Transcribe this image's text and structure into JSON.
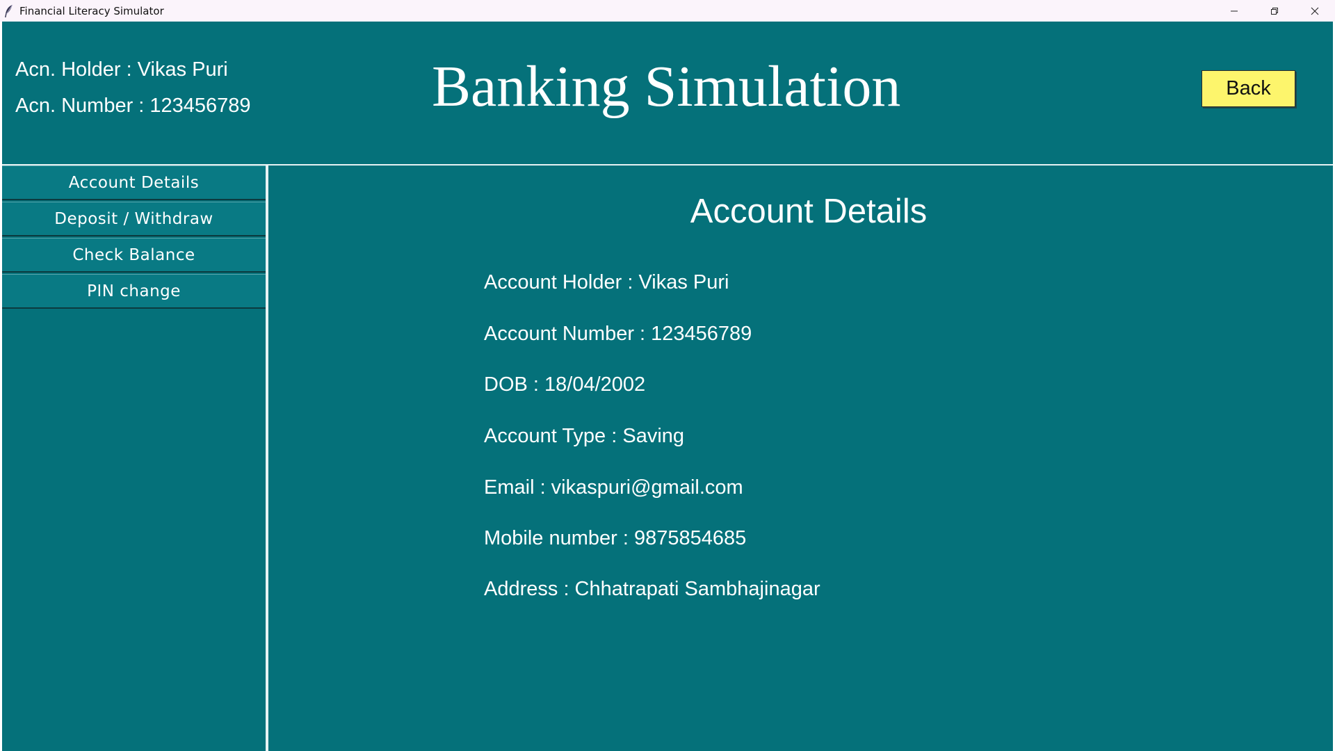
{
  "window": {
    "title": "Financial Literacy Simulator"
  },
  "header": {
    "holder_line": "Acn. Holder : Vikas Puri",
    "number_line": "Acn. Number : 123456789",
    "title": "Banking Simulation",
    "back_label": "Back"
  },
  "sidebar": {
    "items": [
      {
        "label": "Account Details"
      },
      {
        "label": "Deposit / Withdraw"
      },
      {
        "label": "Check Balance"
      },
      {
        "label": "PIN change"
      }
    ]
  },
  "content": {
    "title": "Account Details",
    "details": [
      "Account Holder : Vikas Puri",
      "Account Number : 123456789",
      "DOB : 18/04/2002",
      "Account Type : Saving",
      "Email : vikaspuri@gmail.com",
      "Mobile number : 9875854685",
      "Address : Chhatrapati Sambhajinagar"
    ]
  },
  "colors": {
    "background": "#05717a",
    "back_button": "#fdf56c",
    "text": "#ffffff"
  },
  "icons": {
    "app": "feather-icon",
    "minimize": "minimize-icon",
    "restore": "restore-icon",
    "close": "close-icon"
  }
}
